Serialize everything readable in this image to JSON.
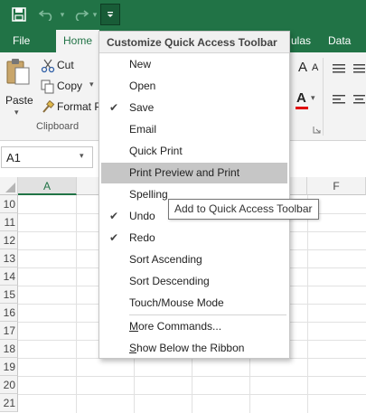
{
  "qat": {
    "save_icon": "save-icon",
    "undo_icon": "undo-icon",
    "redo_icon": "redo-icon",
    "customize_icon": "customize-qat-icon"
  },
  "tabs": {
    "file": "File",
    "home": "Home",
    "formulas_partial": "ulas",
    "data": "Data"
  },
  "ribbon": {
    "paste": "Paste",
    "cut": "Cut",
    "copy": "Copy",
    "format_painter": "Format P",
    "clipboard_group": "Clipboard",
    "font_a": "A",
    "font_a_small": "A",
    "font_color_a": "A"
  },
  "formula_bar": {
    "name_box": "A1"
  },
  "grid": {
    "columns": [
      "A",
      "F"
    ],
    "rows": [
      "10",
      "11",
      "12",
      "13",
      "14",
      "15",
      "16",
      "17",
      "18",
      "19",
      "20",
      "21"
    ]
  },
  "menu": {
    "title": "Customize Quick Access Toolbar",
    "items": [
      {
        "label": "New",
        "checked": false
      },
      {
        "label": "Open",
        "checked": false
      },
      {
        "label": "Save",
        "checked": true
      },
      {
        "label": "Email",
        "checked": false
      },
      {
        "label": "Quick Print",
        "checked": false
      },
      {
        "label": "Print Preview and Print",
        "checked": false
      },
      {
        "label": "Spelling",
        "checked": false
      },
      {
        "label": "Undo",
        "checked": true
      },
      {
        "label": "Redo",
        "checked": true
      },
      {
        "label": "Sort Ascending",
        "checked": false
      },
      {
        "label": "Sort Descending",
        "checked": false
      },
      {
        "label": "Touch/Mouse Mode",
        "checked": false
      }
    ],
    "more_commands_underline": "M",
    "more_commands_rest": "ore Commands...",
    "show_below_underline": "S",
    "show_below_rest": "how Below the Ribbon",
    "checkmark": "✔"
  },
  "tooltip": "Add to Quick Access Toolbar",
  "colors": {
    "excel_green": "#217346",
    "highlight": "#c6c6c6"
  }
}
